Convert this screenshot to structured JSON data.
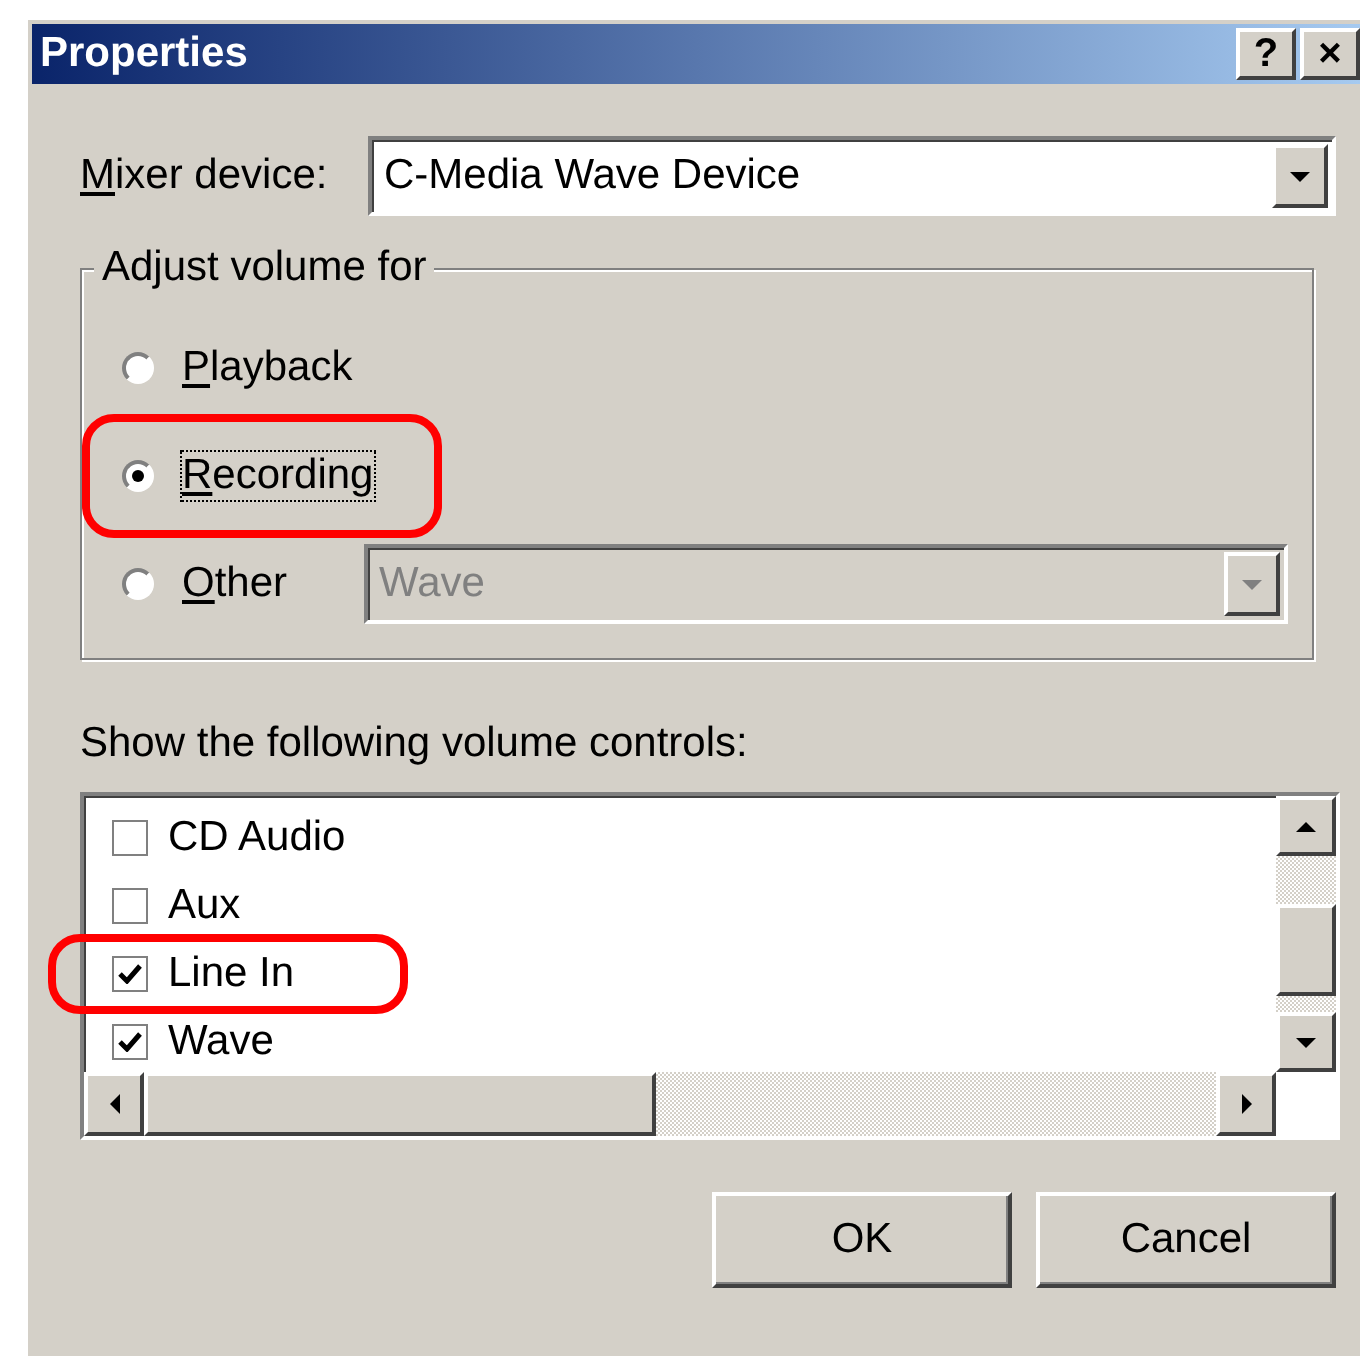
{
  "window": {
    "title": "Properties",
    "buttons": [
      "?",
      "×"
    ]
  },
  "mixer_device": {
    "label": "Mixer device:",
    "value": "C-Media Wave Device"
  },
  "adjust_volume": {
    "title": "Adjust volume for",
    "options": [
      {
        "label": "Playback",
        "selected": false,
        "highlighted": false
      },
      {
        "label": "Recording",
        "selected": true,
        "highlighted": true
      },
      {
        "label": "Other",
        "selected": false,
        "highlighted": false
      }
    ],
    "other_device": {
      "value": "Wave",
      "disabled": true
    }
  },
  "controls_label": "Show the following volume controls:",
  "controls": [
    {
      "label": "CD Audio",
      "checked": false,
      "highlighted": false
    },
    {
      "label": "Aux",
      "checked": false,
      "highlighted": false
    },
    {
      "label": "Line In",
      "checked": true,
      "highlighted": true
    },
    {
      "label": "Wave",
      "checked": true,
      "highlighted": false
    }
  ],
  "buttons": [
    "OK",
    "Cancel"
  ]
}
